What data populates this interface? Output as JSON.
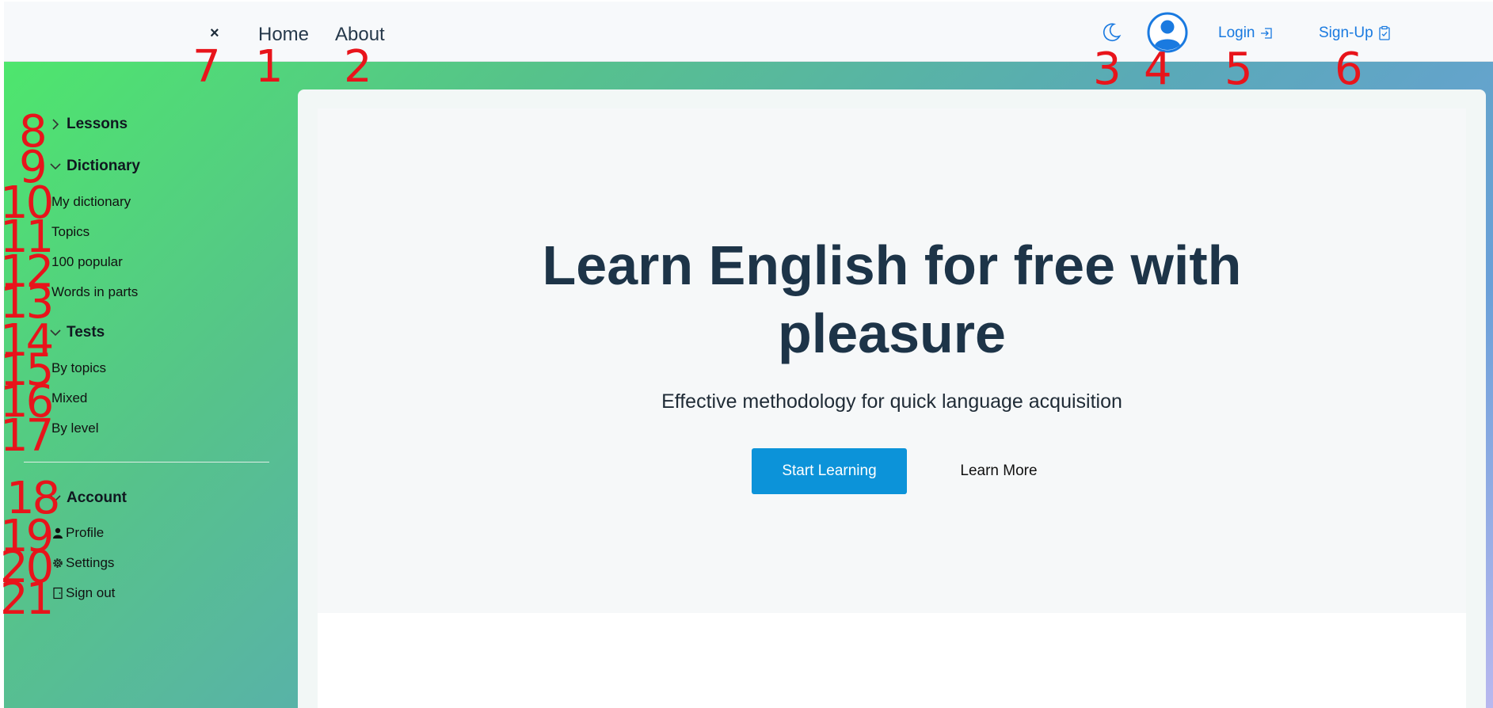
{
  "navbar": {
    "close_label": "×",
    "home_label": "Home",
    "about_label": "About",
    "theme_icon": "moon-icon",
    "avatar_icon": "user-circle-icon",
    "login_label": "Login",
    "signup_label": "Sign-Up"
  },
  "sidebar": {
    "lessons": {
      "label": "Lessons",
      "expanded": false
    },
    "dictionary": {
      "label": "Dictionary",
      "expanded": true,
      "items": [
        "My dictionary",
        "Topics",
        "100 popular",
        "Words in parts"
      ]
    },
    "tests": {
      "label": "Tests",
      "expanded": true,
      "items": [
        "By topics",
        "Mixed",
        "By level"
      ]
    },
    "account": {
      "label": "Account",
      "expanded": true,
      "items": [
        {
          "label": "Profile",
          "icon": "person-icon"
        },
        {
          "label": "Settings",
          "icon": "gear-icon"
        },
        {
          "label": "Sign out",
          "icon": "door-exit-icon"
        }
      ]
    }
  },
  "hero": {
    "title_line1": "Learn English for free with",
    "title_line2": "pleasure",
    "subtitle": "Effective methodology for quick language acquisition",
    "primary_button": "Start Learning",
    "secondary_button": "Learn More"
  },
  "markers": [
    "1",
    "2",
    "3",
    "4",
    "5",
    "6",
    "7",
    "8",
    "9",
    "10",
    "11",
    "12",
    "13",
    "14",
    "15",
    "16",
    "17",
    "18",
    "19",
    "20",
    "21"
  ],
  "colors": {
    "accent": "#1a7ae0",
    "primary_button": "#0c93d9",
    "title": "#1d3448",
    "marker": "#e8141b"
  }
}
